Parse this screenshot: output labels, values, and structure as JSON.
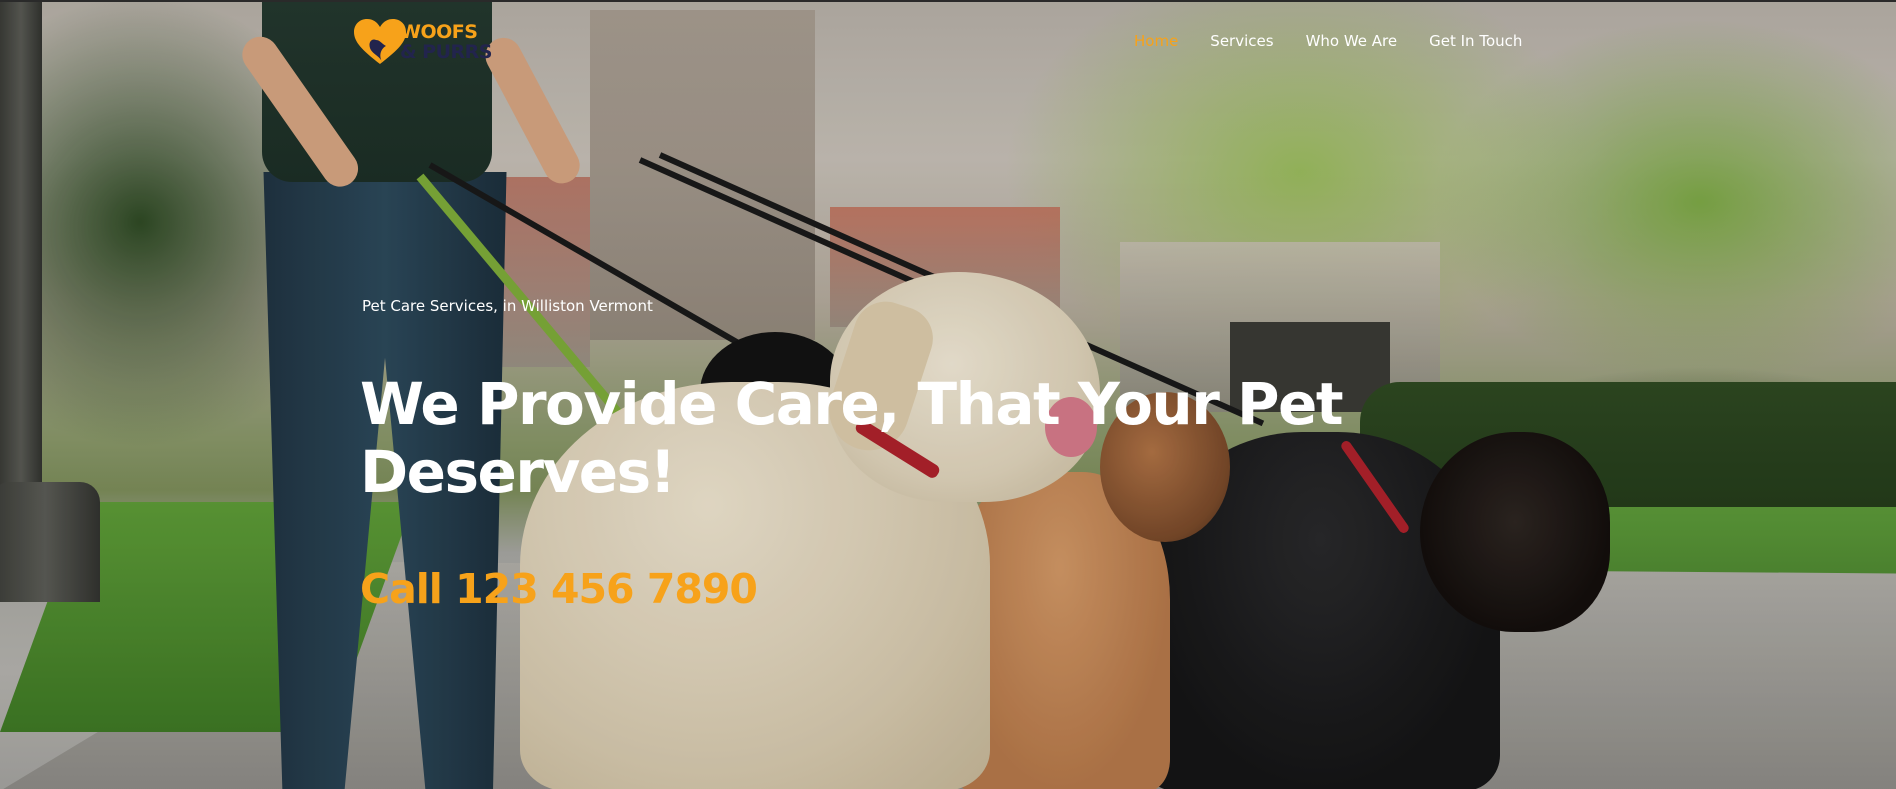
{
  "brand": {
    "line1": "WOOFS",
    "line2": "& PURRS",
    "heart_icon": "heart-pet-icon",
    "accent_color": "#f7a21a",
    "dark_color": "#22244d"
  },
  "nav": {
    "items": [
      {
        "label": "Home",
        "active": true
      },
      {
        "label": "Services",
        "active": false
      },
      {
        "label": "Who We Are",
        "active": false
      },
      {
        "label": "Get In Touch",
        "active": false
      }
    ]
  },
  "hero": {
    "eyebrow": "Pet Care Services, in Williston Vermont",
    "headline": "We Provide Care, That Your Pet Deserves!",
    "phone": "Call 123 456 7890"
  }
}
